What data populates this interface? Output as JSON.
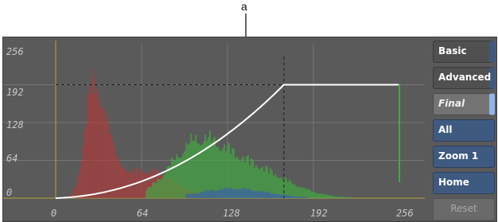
{
  "callout": {
    "label": "a"
  },
  "axes": {
    "x_ticks": [
      "0",
      "64",
      "128",
      "192",
      "256"
    ],
    "y_ticks": [
      "256",
      "192",
      "128",
      "64",
      "0"
    ]
  },
  "buttons": {
    "basic": "Basic",
    "advanced": "Advanced",
    "final": "Final",
    "all": "All",
    "zoom": "Zoom 1",
    "home": "Home",
    "reset": "Reset"
  },
  "colors": {
    "panel_bg": "#5a5a5a",
    "grid": "#777777",
    "red_channel": "#b23a3a",
    "green_channel": "#3fae3f",
    "blue_channel": "#3a62b5",
    "curve": "#ffffff",
    "button_blue": "#3f5a80"
  }
}
